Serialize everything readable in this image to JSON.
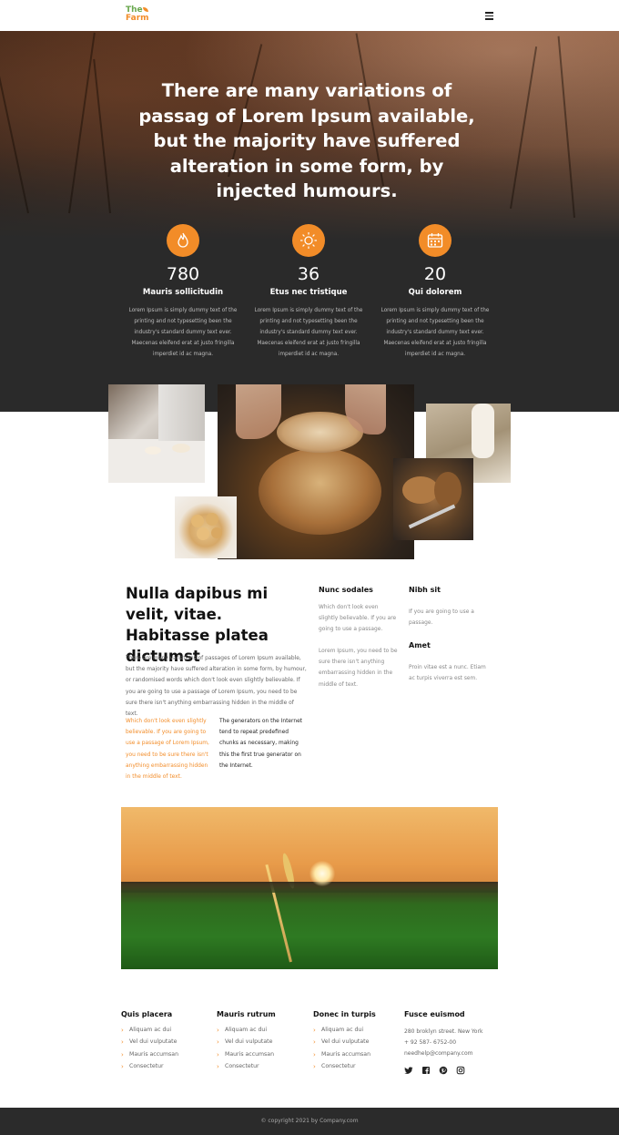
{
  "brand": {
    "line1": "The",
    "line2": "Farm"
  },
  "hero": {
    "title": "There are many variations of passag of Lorem Ipsum available, but the majority have suffered alteration in some form, by injected humours."
  },
  "stats": [
    {
      "icon": "flame-icon",
      "number": "780",
      "label": "Mauris sollicitudin",
      "text": "Lorem Ipsum is simply dummy text of the printing and not typesetting been the industry's standard dummy text ever. Maecenas eleifend erat at justo fringilla imperdiet id ac magna."
    },
    {
      "icon": "sun-icon",
      "number": "36",
      "label": "Etus nec tristique",
      "text": "Lorem Ipsum is simply dummy text of the printing and not typesetting been the industry's standard dummy text ever. Maecenas eleifend erat at justo fringilla imperdiet id ac magna."
    },
    {
      "icon": "calendar-icon",
      "number": "20",
      "label": "Qui dolorem",
      "text": "Lorem Ipsum is simply dummy text of the printing and not typesetting been the industry's standard dummy text ever. Maecenas eleifend erat at justo fringilla imperdiet id ac magna."
    }
  ],
  "content": {
    "heading": "Nulla dapibus mi velit, vitae. Habitasse platea dictumst",
    "paragraph": "There are many variations of passages of Lorem Ipsum available, but the majority have suffered alteration in some form, by humour, or randomised words which don't look even slightly believable. If you are going to use a passage of Lorem Ipsum, you need to be sure there isn't anything embarrassing hidden in the middle of text.",
    "orange_text": "Which don't look even slightly believable. If you are going to use a passage of Lorem Ipsum, you need to be sure there isn't anything embarrassing hidden in the middle of text.",
    "dark_text": "The generators on the Internet tend to repeat predefined chunks as necessary, making this the first true generator on the Internet.",
    "col1": {
      "heading": "Nunc sodales",
      "text1": "Which don't look even slightly believable. If you are going to use a passage.",
      "text2": "Lorem Ipsum, you need to be sure there isn't anything embarrassing hidden in the middle of text."
    },
    "col2": {
      "heading": "Nibh sit",
      "text1": "If you are going to use a passage.",
      "heading2": "Amet",
      "text2": "Proin vitae est a nunc. Etiam ac turpis viverra est sem."
    }
  },
  "footer": {
    "columns": [
      {
        "heading": "Quis placera",
        "items": [
          "Aliquam ac dui",
          "Vel dui vulputate",
          "Mauris accumsan",
          "Consectetur"
        ]
      },
      {
        "heading": "Mauris rutrum",
        "items": [
          "Aliquam ac dui",
          "Vel dui vulputate",
          "Mauris accumsan",
          "Consectetur"
        ]
      },
      {
        "heading": "Donec in turpis",
        "items": [
          "Aliquam ac dui",
          "Vel dui vulputate",
          "Mauris accumsan",
          "Consectetur"
        ]
      }
    ],
    "contact": {
      "heading": "Fusce euismod",
      "address": "280 broklyn street. New York",
      "phone": "+ 92 587- 6752-00",
      "email": "needhelp@company.com"
    },
    "social": [
      "twitter-icon",
      "facebook-icon",
      "pinterest-icon",
      "instagram-icon"
    ],
    "copyright": "© copyright 2021 by Company.com"
  },
  "colors": {
    "accent": "#f28c28",
    "brand_green": "#6aa84f",
    "dark": "#2a2a2a"
  }
}
